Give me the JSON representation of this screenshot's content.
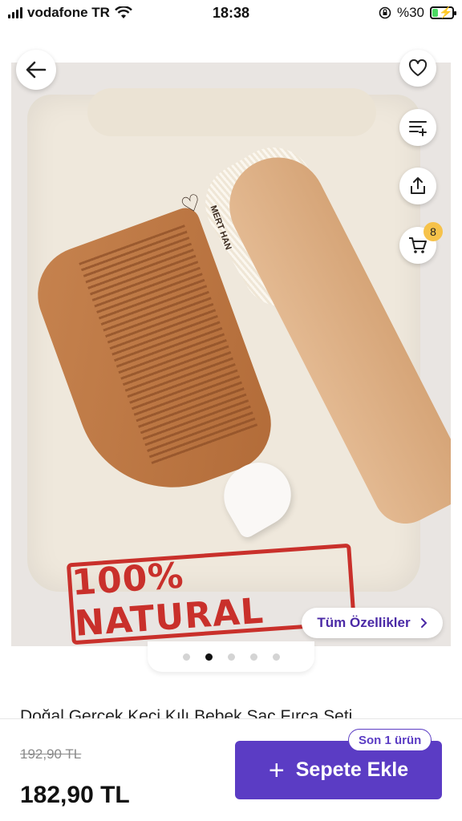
{
  "status_bar": {
    "carrier": "vodafone TR",
    "time": "18:38",
    "battery_text": "%30",
    "battery_level": 0.3
  },
  "product": {
    "image_stamp_text": "100% NATURAL",
    "brush_engraving": "MERT HAN",
    "title": "Doğal Gerçek Keçi Kılı Bebek Saç Fırça Seti",
    "all_features_label": "Tüm Özellikler",
    "carousel": {
      "count": 5,
      "active_index": 1
    }
  },
  "actions": {
    "cart_count": "8"
  },
  "purchase": {
    "old_price": "192,90 TL",
    "price": "182,90 TL",
    "add_to_cart_label": "Sepete Ekle",
    "stock_badge": "Son 1 ürün"
  },
  "icons": [
    "back-arrow-icon",
    "heart-icon",
    "compare-icon",
    "share-icon",
    "cart-icon",
    "chevron-right-icon",
    "plus-icon",
    "wifi-icon",
    "signal-icon",
    "battery-icon",
    "lock-rotation-icon"
  ]
}
